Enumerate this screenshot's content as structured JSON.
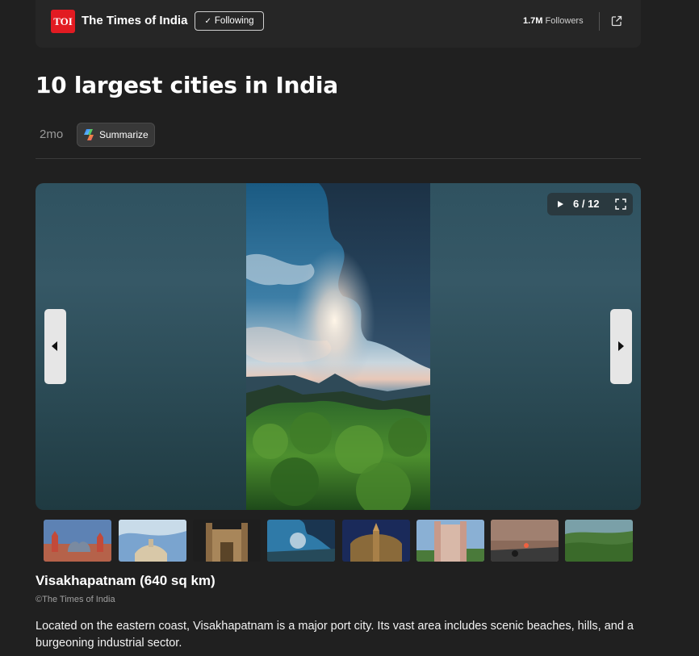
{
  "publisher": {
    "logo_text": "TOI",
    "name": "The Times of India",
    "follow_label": "Following",
    "followers_count": "1.7M",
    "followers_label": "Followers"
  },
  "article": {
    "title": "10 largest cities in India",
    "age": "2mo",
    "summarize_label": "Summarize"
  },
  "slideshow": {
    "counter": "6 / 12",
    "current_index": 6,
    "total": 12
  },
  "caption": {
    "title": "Visakhapatnam (640 sq km)",
    "credit": "©The Times of India",
    "body": "Located on the eastern coast, Visakhapatnam is a major port city. Its vast area includes scenic beaches, hills, and a burgeoning industrial sector."
  },
  "colors": {
    "background": "#202020",
    "toi_red": "#e21b22"
  }
}
